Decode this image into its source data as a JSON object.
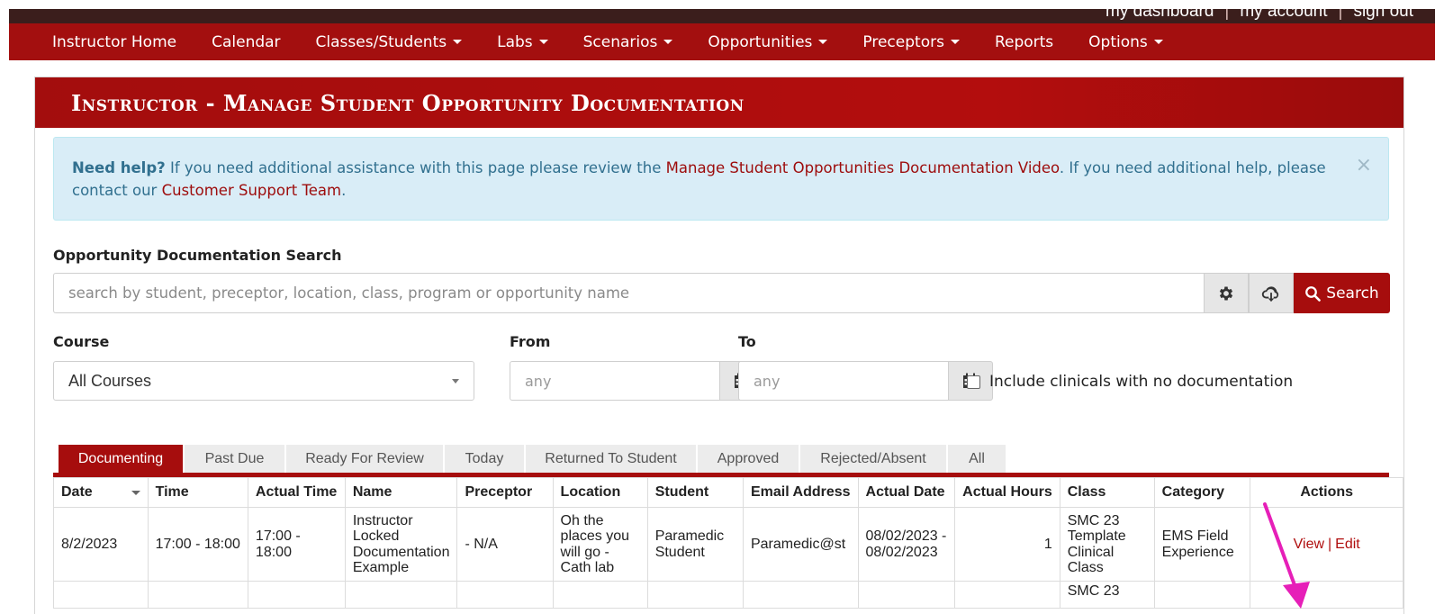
{
  "top_links": [
    "my dashboard",
    "my account",
    "sign out"
  ],
  "nav": [
    {
      "label": "Instructor Home",
      "dropdown": false
    },
    {
      "label": "Calendar",
      "dropdown": false
    },
    {
      "label": "Classes/Students",
      "dropdown": true
    },
    {
      "label": "Labs",
      "dropdown": true
    },
    {
      "label": "Scenarios",
      "dropdown": true
    },
    {
      "label": "Opportunities",
      "dropdown": true
    },
    {
      "label": "Preceptors",
      "dropdown": true
    },
    {
      "label": "Reports",
      "dropdown": false
    },
    {
      "label": "Options",
      "dropdown": true
    }
  ],
  "page_title": "Instructor - Manage Student Opportunity Documentation",
  "alert": {
    "bold": "Need help?",
    "text1": " If you need additional assistance with this page please review the ",
    "link1": "Manage Student Opportunities Documentation Video",
    "text2": ". If you need additional help, please contact our ",
    "link2": "Customer Support Team",
    "text3": ".",
    "close": "×"
  },
  "search": {
    "label": "Opportunity Documentation Search",
    "placeholder": "search by student, preceptor, location, class, program or opportunity name",
    "button": "Search"
  },
  "filters": {
    "course_label": "Course",
    "course_value": "All Courses",
    "from_label": "From",
    "from_placeholder": "any",
    "to_label": "To",
    "to_placeholder": "any",
    "checkbox_label": "Include clinicals with no documentation",
    "checkbox_checked": false
  },
  "tabs": [
    {
      "label": "Documenting",
      "active": true
    },
    {
      "label": "Past Due",
      "active": false
    },
    {
      "label": "Ready For Review",
      "active": false
    },
    {
      "label": "Today",
      "active": false
    },
    {
      "label": "Returned To Student",
      "active": false
    },
    {
      "label": "Approved",
      "active": false
    },
    {
      "label": "Rejected/Absent",
      "active": false
    },
    {
      "label": "All",
      "active": false
    }
  ],
  "table": {
    "columns": [
      "Date",
      "Time",
      "Actual Time",
      "Name",
      "Preceptor",
      "Location",
      "Student",
      "Email Address",
      "Actual Date",
      "Actual Hours",
      "Class",
      "Category",
      "Actions"
    ],
    "rows": [
      {
        "date": "8/2/2023",
        "time": "17:00 - 18:00",
        "actual_time": "17:00 - 18:00",
        "name": "Instructor Locked Documentation Example",
        "preceptor": "- N/A",
        "location": "Oh the places you will go - Cath lab",
        "student": "Paramedic Student",
        "email": "Paramedic@st",
        "actual_date": "08/02/2023 - 08/02/2023",
        "actual_hours": "1",
        "class": "SMC 23 Template Clinical Class",
        "category": "EMS Field Experience",
        "actions": {
          "view": "View",
          "sep": "|",
          "edit": "Edit"
        }
      }
    ],
    "partial_row_class": "SMC 23"
  },
  "colors": {
    "brand_red": "#a30f0f",
    "alert_bg": "#d9edf7",
    "alert_text": "#31708f",
    "annotation_arrow": "#e61fb8"
  }
}
